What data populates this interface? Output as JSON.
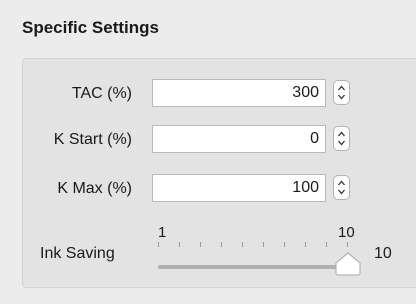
{
  "section": {
    "title": "Specific Settings"
  },
  "fields": [
    {
      "label": "TAC (%)",
      "value": "300"
    },
    {
      "label": "K Start (%)",
      "value": "0"
    },
    {
      "label": "K Max (%)",
      "value": "100"
    }
  ],
  "ink_saving": {
    "label": "Ink Saving",
    "min_label": "1",
    "max_label": "10",
    "value_label": "10",
    "min": 1,
    "max": 10,
    "value": 10,
    "tick_count": 10
  },
  "icons": {
    "stepper": "up-down-chevron-icon",
    "slider_thumb": "slider-thumb-icon"
  }
}
